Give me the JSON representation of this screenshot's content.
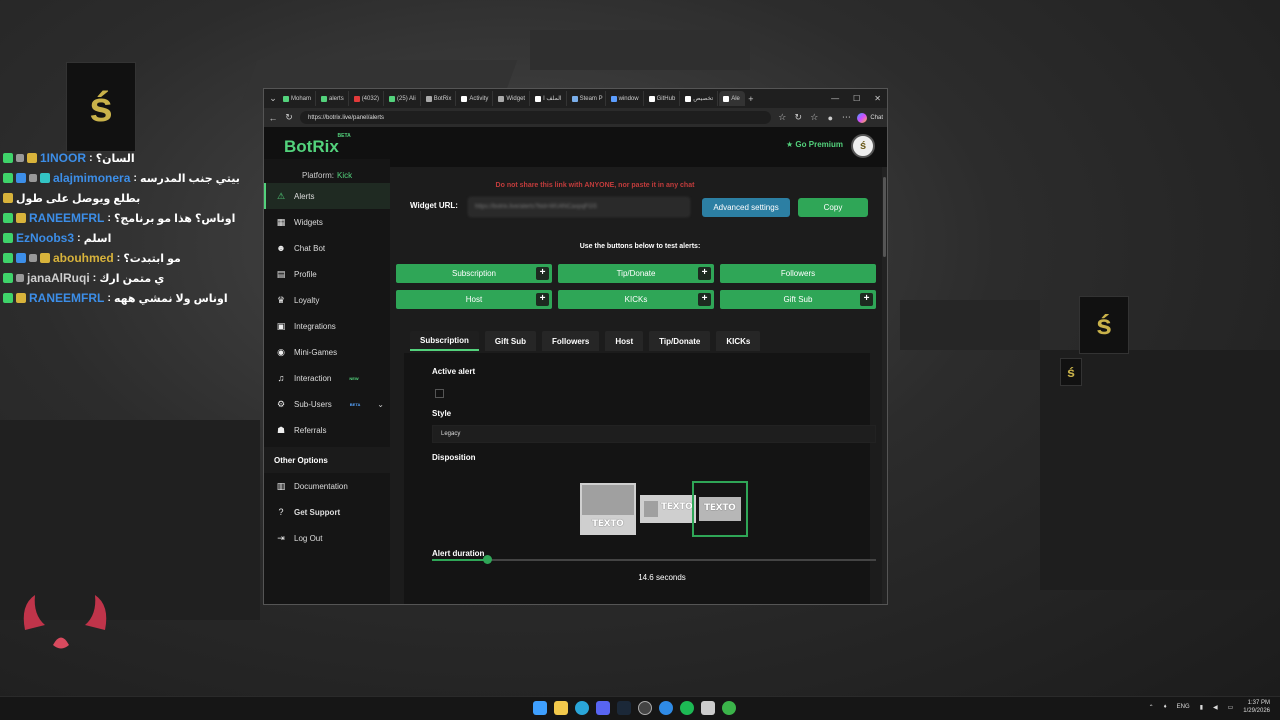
{
  "chat": [
    {
      "user": "1INOOR",
      "user_color": "#3c8ee8",
      "sep": ":",
      "msg": "السان؟",
      "badges": [
        "green",
        "grey",
        "gold"
      ]
    },
    {
      "user": "alajmimonera",
      "user_color": "#3c8ee8",
      "sep": ":",
      "msg": "بيتي جنب المدرسه",
      "badges": [
        "green",
        "blue",
        "grey",
        "teal"
      ]
    },
    {
      "user": "",
      "user_color": "#fff",
      "sep": "",
      "msg": "بطلع ويوصل على طول",
      "badges": []
    },
    {
      "user": "RANEEMFRL",
      "user_color": "#3c8ee8",
      "sep": ":",
      "msg": "اوناس؟ هذا مو برنامج؟",
      "badges": [
        "green",
        "gold"
      ]
    },
    {
      "user": "EzNoobs3",
      "user_color": "#3c8ee8",
      "sep": ":",
      "msg": "اسلم",
      "badges": [
        "green"
      ]
    },
    {
      "user": "abouhmed",
      "user_color": "#d8b33b",
      "sep": ":",
      "msg": "مو ابتبدت؟",
      "badges": [
        "green",
        "blue",
        "grey",
        "gold"
      ]
    },
    {
      "user": "janaAlRuqi",
      "user_color": "#cfcfcf",
      "sep": ":",
      "msg": "ي متمن ارك",
      "badges": [
        "green",
        "grey"
      ]
    },
    {
      "user": "RANEEMFRL",
      "user_color": "#3c8ee8",
      "sep": ":",
      "msg": "اوناس ولا نمشي ههه",
      "badges": [
        "green",
        "gold"
      ]
    }
  ],
  "browser": {
    "tabs": [
      {
        "label": "Moham",
        "color": "#53d27c"
      },
      {
        "label": "alerts",
        "color": "#53d27c"
      },
      {
        "label": "(4032)",
        "color": "#e23a3a"
      },
      {
        "label": "(25) Ali",
        "color": "#53d27c"
      },
      {
        "label": "BotRix",
        "color": "#aaa"
      },
      {
        "label": "Activity",
        "color": "#fff"
      },
      {
        "label": "Widget",
        "color": "#aaa"
      },
      {
        "label": "الملف ا",
        "color": "#fff"
      },
      {
        "label": "Steam P",
        "color": "#7aaeea"
      },
      {
        "label": "window",
        "color": "#5c9eff"
      },
      {
        "label": "GitHub",
        "color": "#fff"
      },
      {
        "label": "تخصيص",
        "color": "#fff"
      },
      {
        "label": "Ale",
        "color": "#fff"
      }
    ],
    "new_tab": "+",
    "url": "https://botrix.live/panel/alerts",
    "chat_label": "Chat"
  },
  "site": {
    "brand": "BotRix",
    "brand_beta": "BETA",
    "go_premium": "Go Premium",
    "platform_label": "Platform:",
    "platform_value": "Kick"
  },
  "sidebar": {
    "items": [
      {
        "label": "Alerts",
        "icon": "warning-icon",
        "glyph": "⚠",
        "active": true
      },
      {
        "label": "Widgets",
        "icon": "widgets-icon",
        "glyph": "▦"
      },
      {
        "label": "Chat Bot",
        "icon": "robot-icon",
        "glyph": "☻"
      },
      {
        "label": "Profile",
        "icon": "profile-icon",
        "glyph": "▤"
      },
      {
        "label": "Loyalty",
        "icon": "trophy-icon",
        "glyph": "♛"
      },
      {
        "label": "Integrations",
        "icon": "integrations-icon",
        "glyph": "▣"
      },
      {
        "label": "Mini-Games",
        "icon": "gamepad-icon",
        "glyph": "◉"
      },
      {
        "label": "Interaction",
        "icon": "music-icon",
        "glyph": "♫",
        "badge": "NEW"
      },
      {
        "label": "Sub-Users",
        "icon": "users-icon",
        "glyph": "⚙",
        "badge": "BETA"
      },
      {
        "label": "Referrals",
        "icon": "referrals-icon",
        "glyph": "☗"
      }
    ],
    "other_heading": "Other Options",
    "other_items": [
      {
        "label": "Documentation",
        "icon": "document-icon",
        "glyph": "▥"
      },
      {
        "label": "Get Support",
        "icon": "support-icon",
        "glyph": "?"
      },
      {
        "label": "Log Out",
        "icon": "logout-icon",
        "glyph": "⇥"
      }
    ]
  },
  "main": {
    "warning": "Do not share this link with ANYONE, nor paste it in any chat",
    "widget_url_label": "Widget URL:",
    "widget_url_value": "https://botrix.live/alerts?bid=WU4NCaxpqFGS",
    "advanced_settings": "Advanced settings",
    "copy": "Copy",
    "test_label": "Use the buttons below to test alerts:",
    "test_buttons": [
      {
        "label": "Subscription",
        "plus": true
      },
      {
        "label": "Tip/Donate",
        "plus": true
      },
      {
        "label": "Followers",
        "plus": false
      },
      {
        "label": "Host",
        "plus": true
      },
      {
        "label": "KICKs",
        "plus": true
      },
      {
        "label": "Gift Sub",
        "plus": true
      }
    ],
    "alert_tabs": [
      "Subscription",
      "Gift Sub",
      "Followers",
      "Host",
      "Tip/Donate",
      "KICKs"
    ],
    "active_tab": "Subscription",
    "active_alert_label": "Active alert",
    "active_alert_checked": false,
    "style_label": "Style",
    "style_value": "Legacy",
    "disposition_label": "Disposition",
    "disposition_text": "TEXTO",
    "disposition_selected": 2,
    "alert_duration_label": "Alert duration",
    "alert_duration_value": "14.6",
    "alert_duration_unit": "seconds",
    "alert_duration_fraction": 0.123
  },
  "taskbar": {
    "lang": "ENG",
    "time": "1:37 PM",
    "date": "1/29/2026"
  }
}
